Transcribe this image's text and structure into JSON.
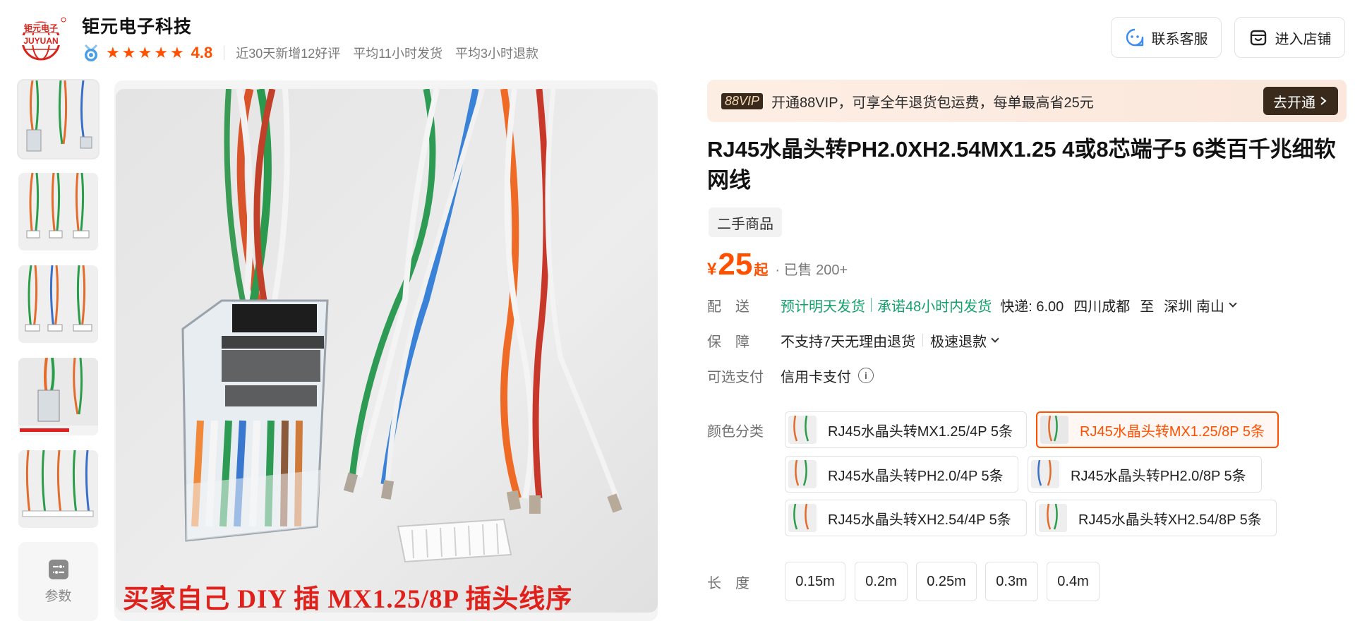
{
  "shop": {
    "name": "钜元电子科技",
    "logo_text_top": "钜元电子",
    "logo_text_bottom": "JUYUAN",
    "rating": "4.8",
    "stats": [
      "近30天新增12好评",
      "平均11小时发货",
      "平均3小时退款"
    ],
    "service_label": "联系客服",
    "store_label": "进入店铺"
  },
  "gallery": {
    "params_label": "参数",
    "caption": "买家自己 DIY 插 MX1.25/8P 插头线序"
  },
  "vip": {
    "badge": "88VIP",
    "text": "开通88VIP，可享全年退货包运费，每单最高省25元",
    "cta": "去开通"
  },
  "product": {
    "title": "RJ45水晶头转PH2.0XH2.54MX1.25 4或8芯端子5 6类百千兆细软网线",
    "tag": "二手商品",
    "currency": "¥",
    "price": "25",
    "price_suffix": "起",
    "sold": "· 已售 200+"
  },
  "shipping": {
    "label": "配　送",
    "eta": "预计明天发货",
    "promise": "承诺48小时内发货",
    "fee": "快递: 6.00",
    "from": "四川成都",
    "to_word": "至",
    "dest": "深圳 南山"
  },
  "guarantee": {
    "label": "保　障",
    "text": "不支持7天无理由退货",
    "refund": "极速退款"
  },
  "payment": {
    "label": "可选支付",
    "method": "信用卡支付"
  },
  "color": {
    "label": "颜色分类",
    "options": [
      "RJ45水晶头转MX1.25/4P 5条",
      "RJ45水晶头转MX1.25/8P 5条",
      "RJ45水晶头转PH2.0/4P 5条",
      "RJ45水晶头转PH2.0/8P 5条",
      "RJ45水晶头转XH2.54/4P 5条",
      "RJ45水晶头转XH2.54/8P 5条"
    ],
    "selected": "RJ45水晶头转MX1.25/8P 5条"
  },
  "length": {
    "label": "长　度",
    "options": [
      "0.15m",
      "0.2m",
      "0.25m",
      "0.3m",
      "0.4m"
    ]
  },
  "colors": {
    "accent": "#ff5000",
    "green": "#14a06b",
    "vip_dark": "#3a2a1c"
  }
}
